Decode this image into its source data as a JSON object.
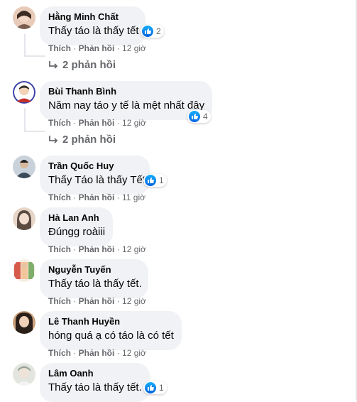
{
  "comments": [
    {
      "author": "Hằng Minh Chất",
      "text": "Thấy táo là thấy tết",
      "likes": "2",
      "like_label": "Thích",
      "reply_label": "Phản hồi",
      "time": "12 giờ",
      "replies": "2 phản hồi",
      "avatar_colors": [
        "#7a5d4f",
        "#e8cbb8"
      ]
    },
    {
      "author": "Bùi Thanh Bình",
      "text": "Năm nay táo y tế là mệt nhất đây",
      "likes": "4",
      "like_label": "Thích",
      "reply_label": "Phản hồi",
      "time": "12 giờ",
      "replies": "2 phản hồi",
      "avatar_colors": [
        "#3b3fa8",
        "#f2d3b8"
      ]
    },
    {
      "author": "Trần Quốc Huy",
      "text": "Thấy Táo là thấy Tết",
      "likes": "1",
      "like_label": "Thích",
      "reply_label": "Phản hồi",
      "time": "11 giờ",
      "avatar_colors": [
        "#3a4a5a",
        "#c9d2da"
      ]
    },
    {
      "author": "Hà Lan Anh",
      "text": "Đúngg roàiii",
      "like_label": "Thích",
      "reply_label": "Phản hồi",
      "time": "12 giờ",
      "avatar_colors": [
        "#5a4a3f",
        "#e7d6c8"
      ]
    },
    {
      "author": "Nguyễn Tuyến",
      "text": "Thấy táo là thấy tết.",
      "like_label": "Thích",
      "reply_label": "Phản hồi",
      "time": "12 giờ",
      "avatar_colors": [
        "#d65b4a",
        "#f3c59a"
      ]
    },
    {
      "author": "Lê Thanh Huyền",
      "text": "hóng quá ạ có táo là có tết",
      "like_label": "Thích",
      "reply_label": "Phản hồi",
      "time": "12 giờ",
      "avatar_colors": [
        "#2b1f1a",
        "#caa27e"
      ]
    },
    {
      "author": "Lâm Oanh",
      "text": "Thấy táo là thấy tết.",
      "likes": "1",
      "like_label": "Thích",
      "reply_label": "Phản hồi",
      "time": "12 giờ",
      "avatar_colors": [
        "#9aa39a",
        "#e2e6df"
      ]
    }
  ],
  "colors": {
    "bubble": "#f0f2f5",
    "meta": "#65676b",
    "like_blue": "#0866ff"
  }
}
